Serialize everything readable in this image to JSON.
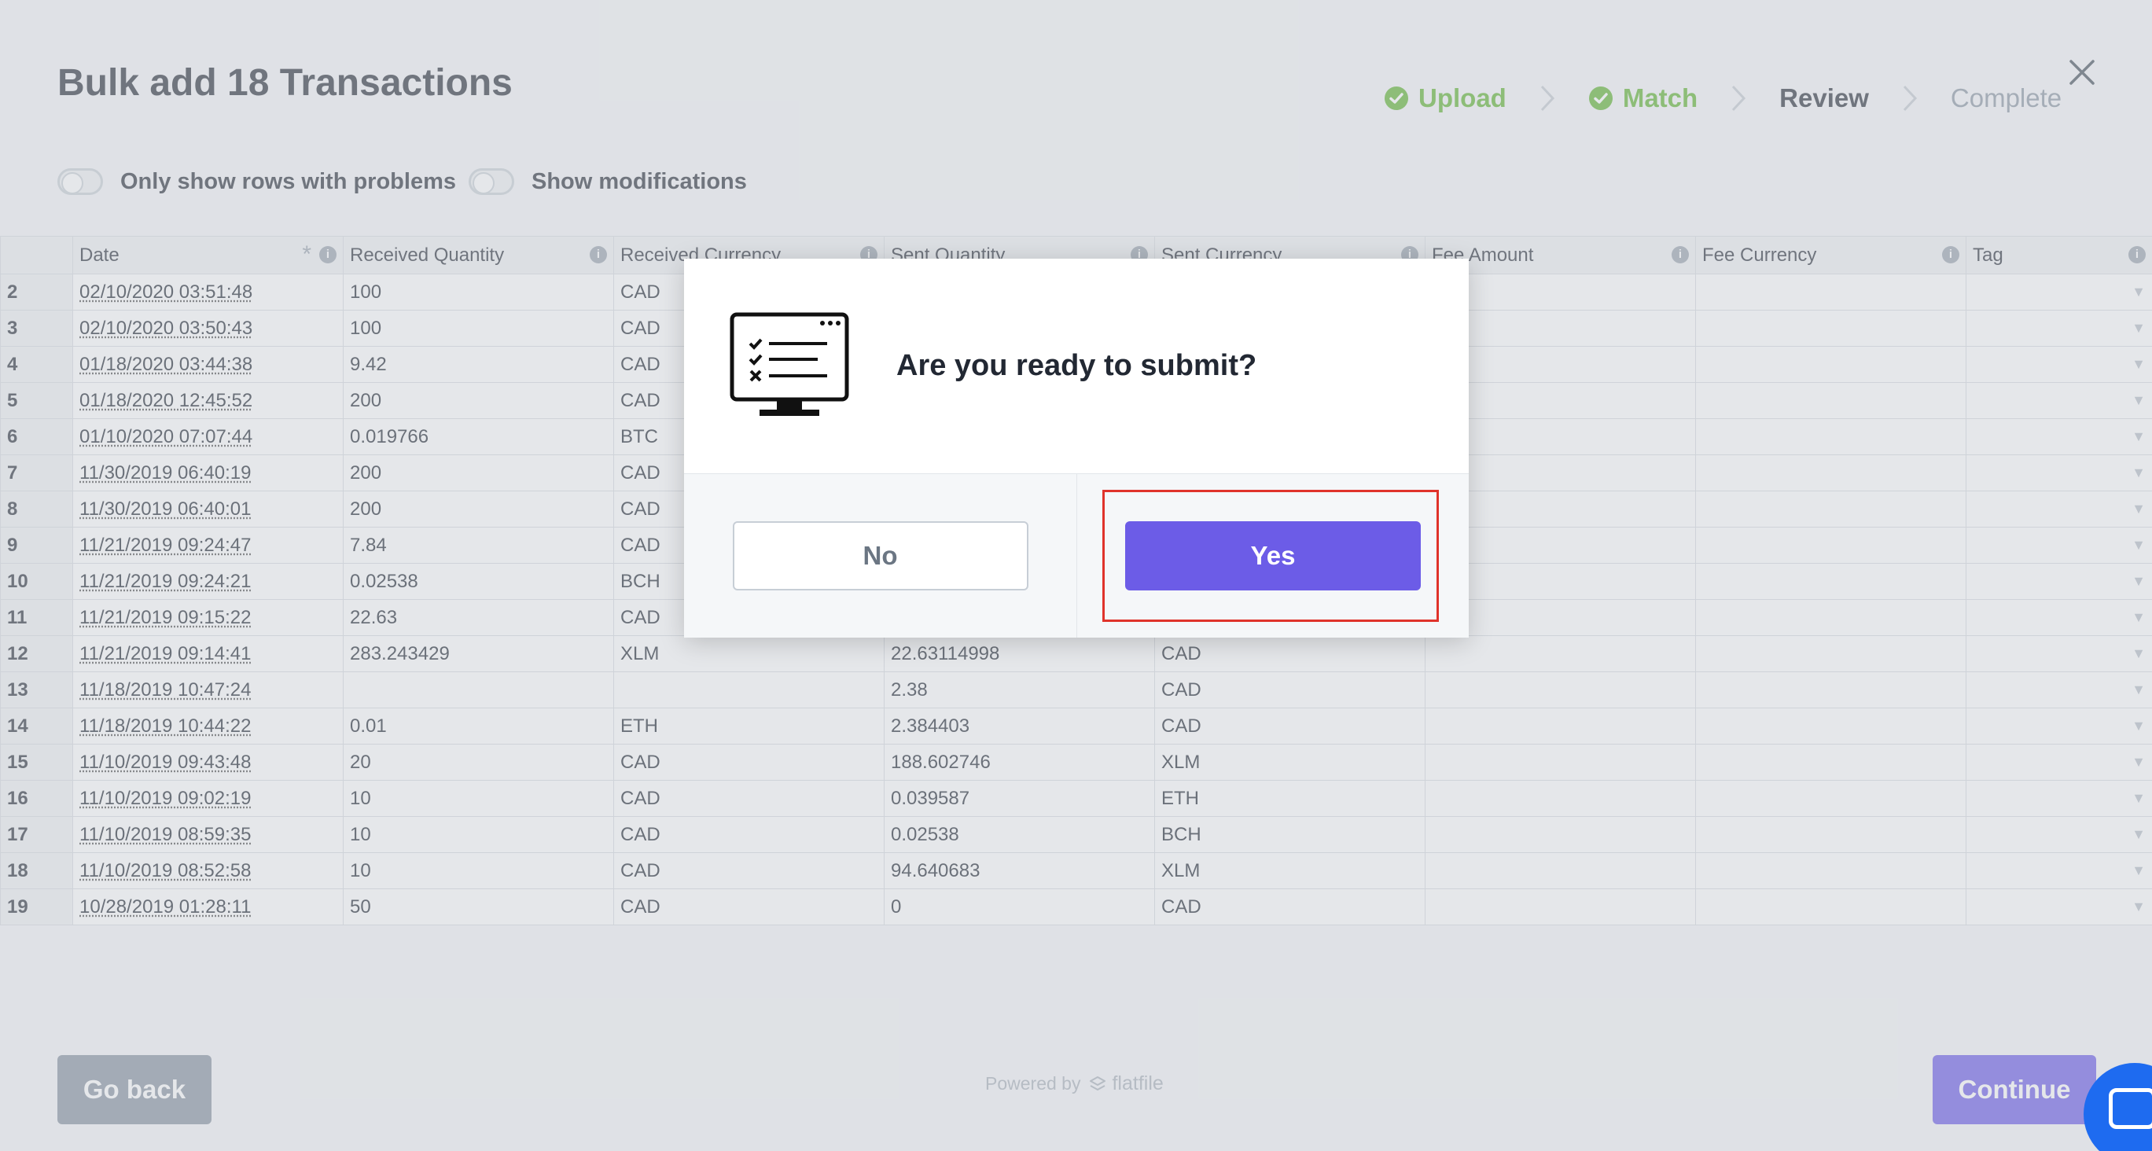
{
  "header": {
    "title": "Bulk add 18 Transactions",
    "steps": [
      {
        "label": "Upload",
        "state": "done"
      },
      {
        "label": "Match",
        "state": "done"
      },
      {
        "label": "Review",
        "state": "current"
      },
      {
        "label": "Complete",
        "state": "todo"
      }
    ]
  },
  "toggles": {
    "problems_label": "Only show rows with problems",
    "modifications_label": "Show modifications"
  },
  "table": {
    "columns": [
      "Date",
      "Received Quantity",
      "Received Currency",
      "Sent Quantity",
      "Sent Currency",
      "Fee Amount",
      "Fee Currency",
      "Tag"
    ],
    "rows": [
      {
        "n": "2",
        "date": "02/10/2020 03:51:48",
        "rq": "100",
        "rc": "CAD",
        "sq": "",
        "sc": ""
      },
      {
        "n": "3",
        "date": "02/10/2020 03:50:43",
        "rq": "100",
        "rc": "CAD",
        "sq": "",
        "sc": ""
      },
      {
        "n": "4",
        "date": "01/18/2020 03:44:38",
        "rq": "9.42",
        "rc": "CAD",
        "sq": "",
        "sc": ""
      },
      {
        "n": "5",
        "date": "01/18/2020 12:45:52",
        "rq": "200",
        "rc": "CAD",
        "sq": "",
        "sc": ""
      },
      {
        "n": "6",
        "date": "01/10/2020 07:07:44",
        "rq": "0.019766",
        "rc": "BTC",
        "sq": "",
        "sc": ""
      },
      {
        "n": "7",
        "date": "11/30/2019 06:40:19",
        "rq": "200",
        "rc": "CAD",
        "sq": "",
        "sc": ""
      },
      {
        "n": "8",
        "date": "11/30/2019 06:40:01",
        "rq": "200",
        "rc": "CAD",
        "sq": "",
        "sc": ""
      },
      {
        "n": "9",
        "date": "11/21/2019 09:24:47",
        "rq": "7.84",
        "rc": "CAD",
        "sq": "",
        "sc": ""
      },
      {
        "n": "10",
        "date": "11/21/2019 09:24:21",
        "rq": "0.02538",
        "rc": "BCH",
        "sq": "",
        "sc": ""
      },
      {
        "n": "11",
        "date": "11/21/2019 09:15:22",
        "rq": "22.63",
        "rc": "CAD",
        "sq": "",
        "sc": ""
      },
      {
        "n": "12",
        "date": "11/21/2019 09:14:41",
        "rq": "283.243429",
        "rc": "XLM",
        "sq": "22.63114998",
        "sc": "CAD"
      },
      {
        "n": "13",
        "date": "11/18/2019 10:47:24",
        "rq": "",
        "rc": "",
        "sq": "2.38",
        "sc": "CAD"
      },
      {
        "n": "14",
        "date": "11/18/2019 10:44:22",
        "rq": "0.01",
        "rc": "ETH",
        "sq": "2.384403",
        "sc": "CAD"
      },
      {
        "n": "15",
        "date": "11/10/2019 09:43:48",
        "rq": "20",
        "rc": "CAD",
        "sq": "188.602746",
        "sc": "XLM"
      },
      {
        "n": "16",
        "date": "11/10/2019 09:02:19",
        "rq": "10",
        "rc": "CAD",
        "sq": "0.039587",
        "sc": "ETH"
      },
      {
        "n": "17",
        "date": "11/10/2019 08:59:35",
        "rq": "10",
        "rc": "CAD",
        "sq": "0.02538",
        "sc": "BCH"
      },
      {
        "n": "18",
        "date": "11/10/2019 08:52:58",
        "rq": "10",
        "rc": "CAD",
        "sq": "94.640683",
        "sc": "XLM"
      },
      {
        "n": "19",
        "date": "10/28/2019 01:28:11",
        "rq": "50",
        "rc": "CAD",
        "sq": "0",
        "sc": "CAD"
      }
    ]
  },
  "modal": {
    "question": "Are you ready to submit?",
    "no_label": "No",
    "yes_label": "Yes"
  },
  "footer": {
    "go_back_label": "Go back",
    "continue_label": "Continue",
    "powered_by": "Powered by",
    "brand": "flatfile"
  },
  "colors": {
    "accent": "#6c5ce7",
    "done_green": "#5fb230",
    "focus_red": "#e0332b"
  },
  "icons": {
    "close": "close-icon",
    "step_check": "check-circle-icon",
    "step_sep": "chevron-right-icon",
    "info": "info-icon",
    "monitor": "checklist-monitor-icon",
    "chat": "chat-icon"
  }
}
